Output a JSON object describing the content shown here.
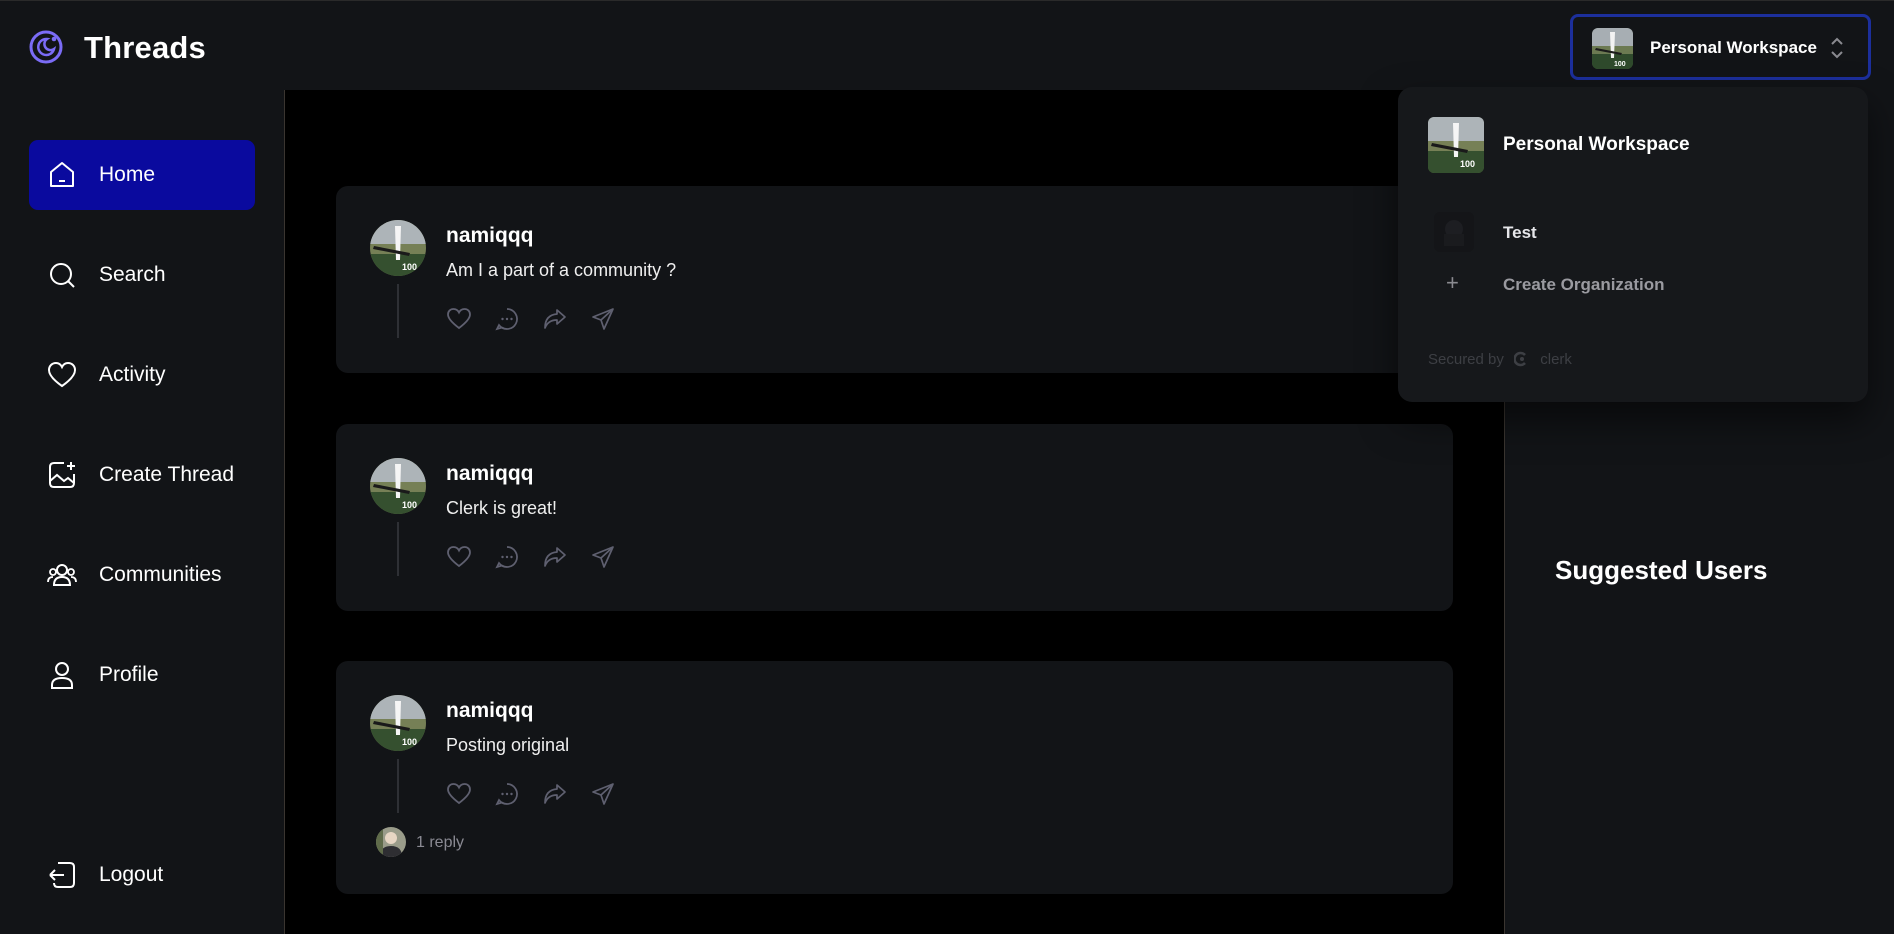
{
  "app": {
    "title": "Threads"
  },
  "workspace_switcher": {
    "label": "Personal Workspace"
  },
  "sidebar": {
    "items": [
      {
        "label": "Home",
        "icon": "home-icon",
        "active": true
      },
      {
        "label": "Search",
        "icon": "search-icon",
        "active": false
      },
      {
        "label": "Activity",
        "icon": "heart-icon",
        "active": false
      },
      {
        "label": "Create Thread",
        "icon": "image-plus-icon",
        "active": false
      },
      {
        "label": "Communities",
        "icon": "users-icon",
        "active": false
      },
      {
        "label": "Profile",
        "icon": "user-icon",
        "active": false
      }
    ],
    "logout_label": "Logout"
  },
  "feed": {
    "threads": [
      {
        "author": "namiqqq",
        "content": "Am I a part of a community ?"
      },
      {
        "author": "namiqqq",
        "content": "Clerk is great!"
      },
      {
        "author": "namiqqq",
        "content": "Posting original",
        "replies": "1 reply"
      }
    ]
  },
  "rightbar": {
    "suggested_title": "Suggested Users"
  },
  "dropdown": {
    "current": "Personal Workspace",
    "orgs": [
      {
        "name": "Test"
      }
    ],
    "create_label": "Create Organization",
    "secured_by": "Secured by",
    "brand": "clerk"
  },
  "colors": {
    "accent": "#0a0a9e",
    "panel": "#121417",
    "background": "#000000",
    "logo": "#7b6cf6"
  }
}
